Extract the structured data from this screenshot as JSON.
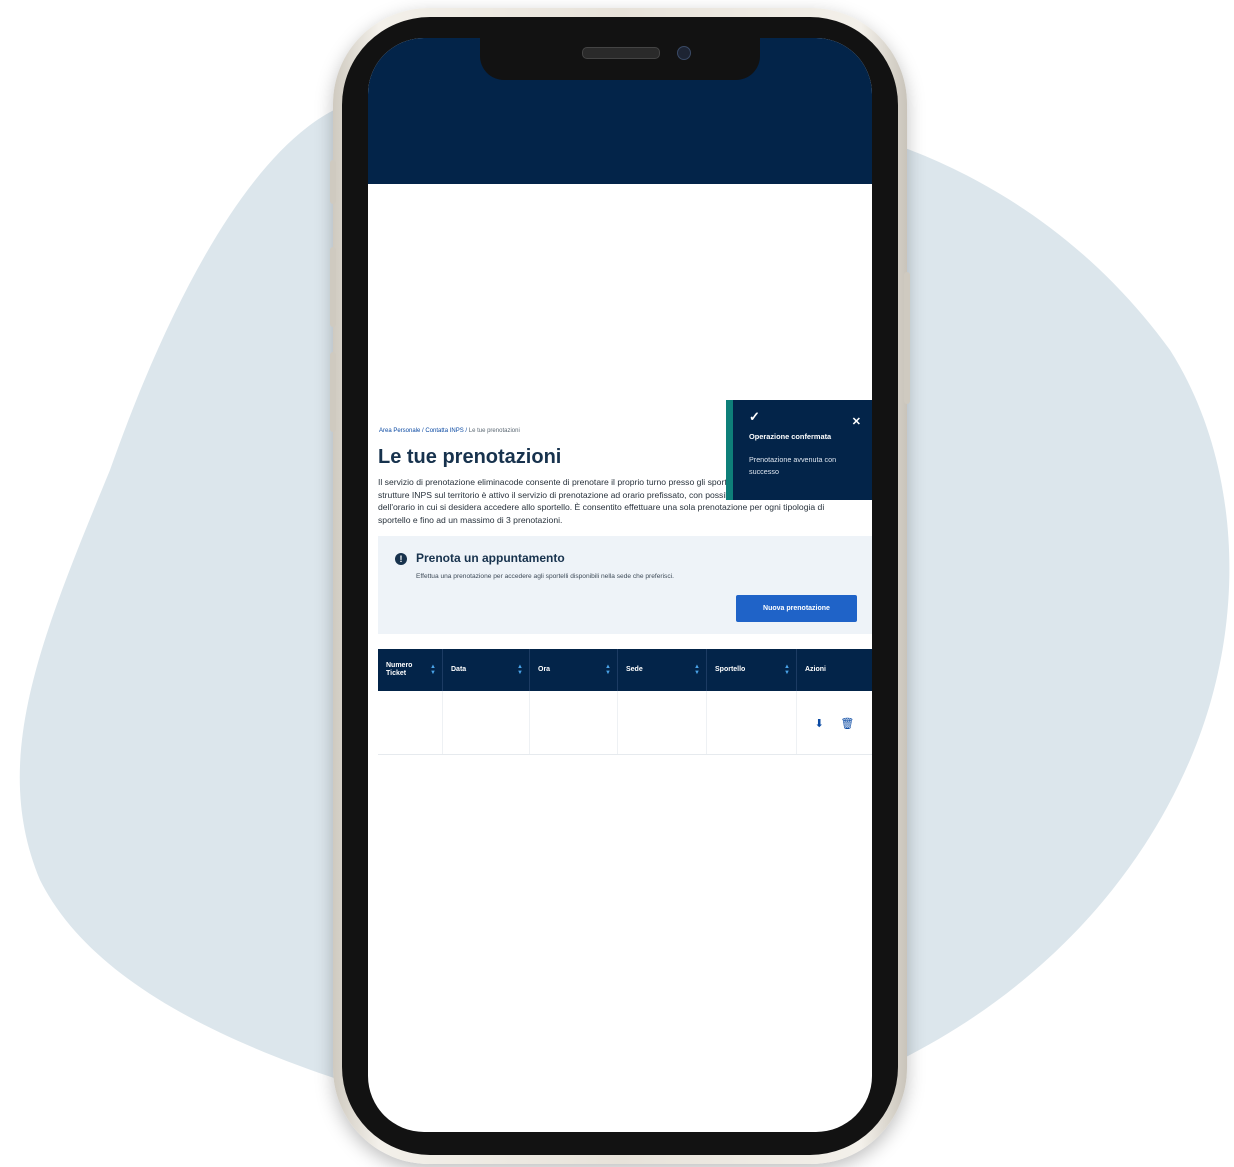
{
  "breadcrumb": {
    "items": [
      "Area Personale",
      "Contatta INPS",
      "Le tue prenotazioni"
    ],
    "separator": "/"
  },
  "page": {
    "title": "Le tue prenotazioni",
    "intro": "Il servizio di prenotazione eliminacode consente di prenotare il proprio turno presso gli sportelli delle strutture INPS. Nelle strutture INPS sul territorio è attivo il servizio di prenotazione ad orario prefissato, con possibilità di scelta del giorno e dell'orario in cui si desidera accedere allo sportello. È consentito effettuare una sola prenotazione per ogni tipologia di sportello e fino ad un massimo di 3 prenotazioni."
  },
  "appointment_card": {
    "icon": "info-icon",
    "title": "Prenota un appuntamento",
    "description": "Effettua una prenotazione per accedere agli sportelli disponibili nella sede che preferisci.",
    "button_label": "Nuova prenotazione"
  },
  "table": {
    "columns": [
      {
        "label": "Numero Ticket",
        "sortable": true
      },
      {
        "label": "Data",
        "sortable": true
      },
      {
        "label": "Ora",
        "sortable": true
      },
      {
        "label": "Sede",
        "sortable": true
      },
      {
        "label": "Sportello",
        "sortable": true
      },
      {
        "label": "Azioni",
        "sortable": false
      }
    ],
    "rows": [
      {
        "ticket": "",
        "data": "",
        "ora": "",
        "sede": "",
        "sportello": "",
        "actions": [
          "download-icon",
          "trash-icon"
        ]
      }
    ]
  },
  "toast": {
    "icon": "check-icon",
    "title": "Operazione confermata",
    "message": "Prenotazione avvenuta con successo",
    "close_icon": "close-icon"
  },
  "colors": {
    "navy": "#032449",
    "primary_blue": "#1f63c8",
    "teal_accent": "#0e7f79",
    "blob_background": "#dce6ec",
    "card_background": "#eef3f8"
  }
}
